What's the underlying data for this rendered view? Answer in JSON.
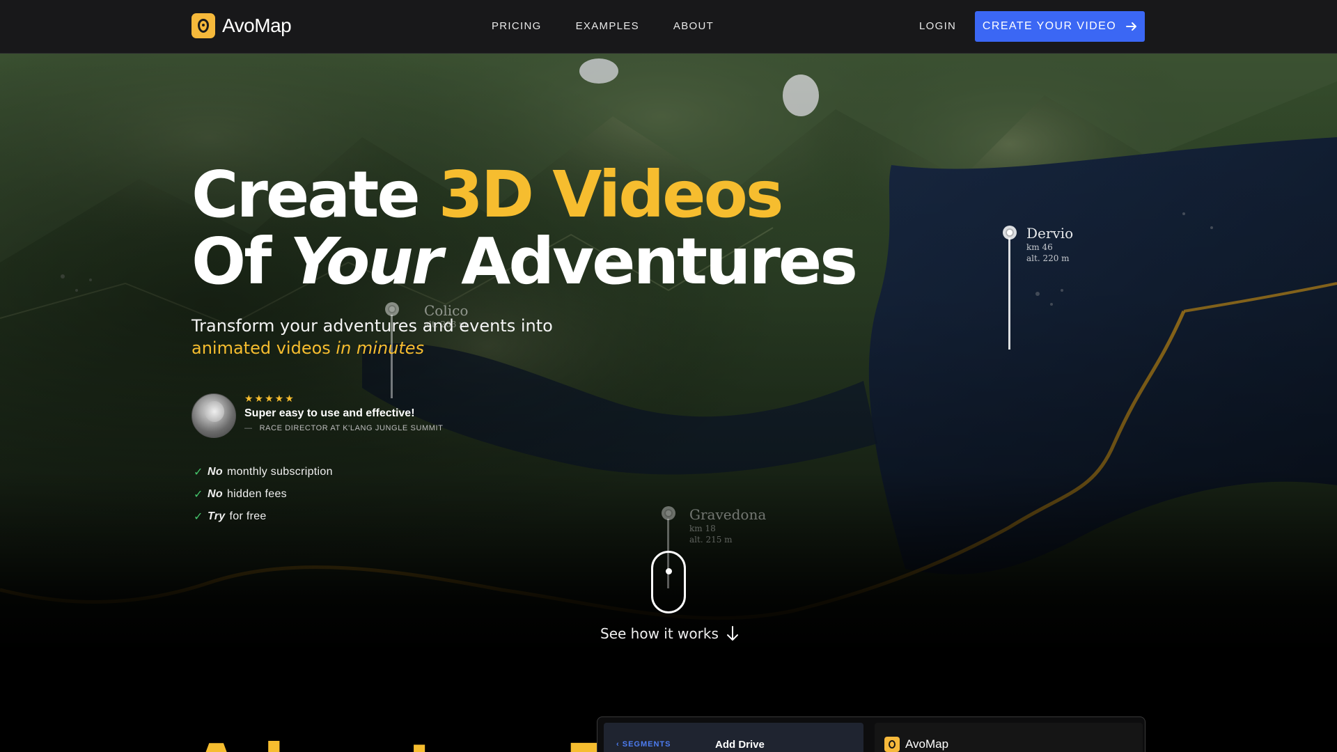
{
  "nav": {
    "brand": "AvoMap",
    "links": [
      "PRICING",
      "EXAMPLES",
      "ABOUT"
    ],
    "login": "LOGIN",
    "cta": "CREATE YOUR VIDEO"
  },
  "hero": {
    "headline": {
      "line1_plain": "Create ",
      "line1_accent": "3D Videos",
      "line2_of": "Of ",
      "line2_your": "Your",
      "line2_rest": " Adventures"
    },
    "subtitle": {
      "line1": "Transform your adventures and events into",
      "accent": "animated videos ",
      "accent_italic": "in minutes"
    },
    "review": {
      "stars": "★★★★★",
      "quote": "Super easy to use and effective!",
      "source": "RACE DIRECTOR AT K'LANG JUNGLE SUMMIT"
    },
    "checks": [
      {
        "bold": "No",
        "text": "monthly subscription"
      },
      {
        "bold": "No",
        "text": "hidden fees"
      },
      {
        "bold": "Try",
        "text": "for free"
      }
    ],
    "see_how": "See how it works"
  },
  "map_labels": [
    {
      "name": "Dervio",
      "km": "km 46",
      "alt": "alt. 220 m"
    },
    {
      "name": "Colico",
      "km": "",
      "alt": "alt. 203 m"
    },
    {
      "name": "Gravedona",
      "km": "km 18",
      "alt": "alt. 215 m"
    }
  ],
  "preview": {
    "segments": "SEGMENTS",
    "add_drive": "Add Drive",
    "brand": "AvoMap",
    "peek_title": "Adventure T"
  },
  "colors": {
    "accent": "#f6bd2f",
    "cta": "#3b67f4",
    "nav_bg": "#18181a"
  }
}
